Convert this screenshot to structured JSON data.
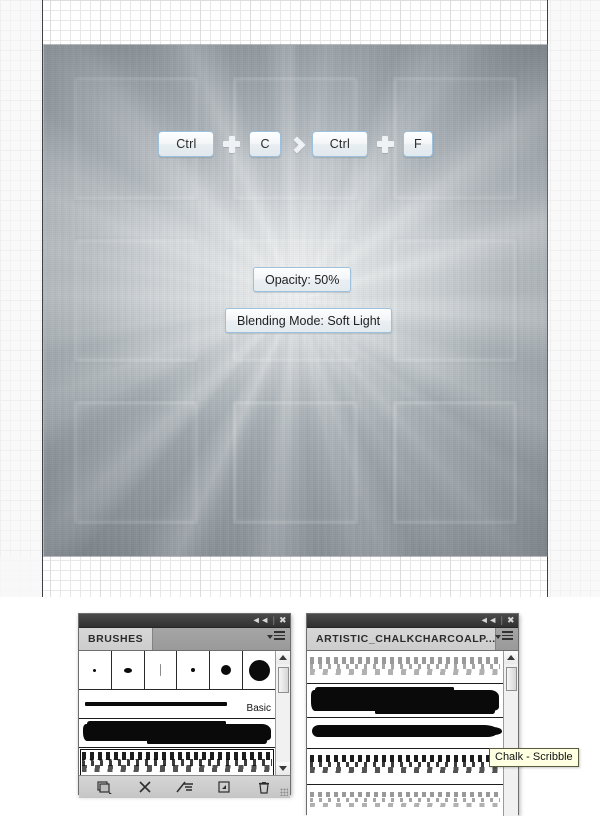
{
  "workspace": {
    "background": "#ffffff",
    "grid_minor_color": "#e7e7e7",
    "grid_major_color": "#dcdcdc",
    "guide_color": "#3d4044"
  },
  "canvas": {
    "name": "brushed-metal-artboard",
    "accent_border": "#9dc0dd",
    "chalk_rect_count": 9,
    "shortcut_row": [
      {
        "type": "key",
        "label": "Ctrl",
        "wide": true
      },
      {
        "type": "plus",
        "label": "plus-icon"
      },
      {
        "type": "key",
        "label": "C",
        "wide": false
      },
      {
        "type": "chevron",
        "label": "chevron-right-icon"
      },
      {
        "type": "key",
        "label": "Ctrl",
        "wide": true
      },
      {
        "type": "plus",
        "label": "plus-icon"
      },
      {
        "type": "key",
        "label": "F",
        "wide": false
      }
    ],
    "badges": {
      "opacity": "Opacity: 50%",
      "blending": "Blending Mode: Soft Light"
    }
  },
  "panels": [
    {
      "id": "brushes",
      "tab_label": "BRUSHES",
      "collapse_icon": "collapse-to-icons-icon",
      "close_icon": "close-icon",
      "menu_icon": "panel-menu-icon",
      "brush_tips": [
        {
          "name": "brush-tip-1",
          "size": 3
        },
        {
          "name": "brush-tip-2",
          "size": 7
        },
        {
          "name": "brush-tip-3",
          "size": 1
        },
        {
          "name": "brush-tip-4",
          "size": 4
        },
        {
          "name": "brush-tip-5",
          "size": 10
        },
        {
          "name": "brush-tip-6",
          "size": 20
        }
      ],
      "stroke_rows": [
        {
          "name": "brush-basic",
          "label": "Basic",
          "style": "basic",
          "selected": false
        },
        {
          "name": "brush-charcoal-slab",
          "label": "",
          "style": "slab",
          "selected": false
        },
        {
          "name": "brush-chalk-scribble",
          "label": "",
          "style": "scribble",
          "selected": true
        }
      ],
      "scrollbar": {
        "up_icon": "scroll-up-arrow-icon",
        "down_icon": "scroll-down-arrow-icon",
        "thumb": "scroll-thumb"
      },
      "footer_buttons": [
        {
          "name": "brush-preset-manager-icon"
        },
        {
          "name": "clear-brush-controls-icon"
        },
        {
          "name": "brush-settings-icon"
        },
        {
          "name": "new-brush-preset-icon"
        },
        {
          "name": "delete-brush-icon"
        }
      ]
    },
    {
      "id": "chalk-charcoal",
      "tab_label": "ARTISTIC_CHALKCHARCOALP...",
      "collapse_icon": "collapse-to-icons-icon",
      "close_icon": "close-icon",
      "menu_icon": "panel-menu-icon",
      "stroke_rows": [
        {
          "name": "chalk-preset-1",
          "label": "",
          "style": "scribble-light",
          "selected": false
        },
        {
          "name": "chalk-preset-2",
          "label": "",
          "style": "slab",
          "selected": false
        },
        {
          "name": "chalk-preset-3",
          "label": "",
          "style": "bar",
          "selected": false
        },
        {
          "name": "chalk-preset-4",
          "label": "",
          "style": "scribble",
          "selected": false
        },
        {
          "name": "chalk-preset-5",
          "label": "",
          "style": "scribble-wispy",
          "selected": false
        }
      ],
      "scrollbar": {
        "up_icon": "scroll-up-arrow-icon",
        "down_icon": "scroll-down-arrow-icon",
        "thumb": "scroll-thumb"
      }
    }
  ],
  "tooltip": {
    "text": "Chalk - Scribble",
    "background": "#ffffe1",
    "border": "#5a5a3c"
  }
}
